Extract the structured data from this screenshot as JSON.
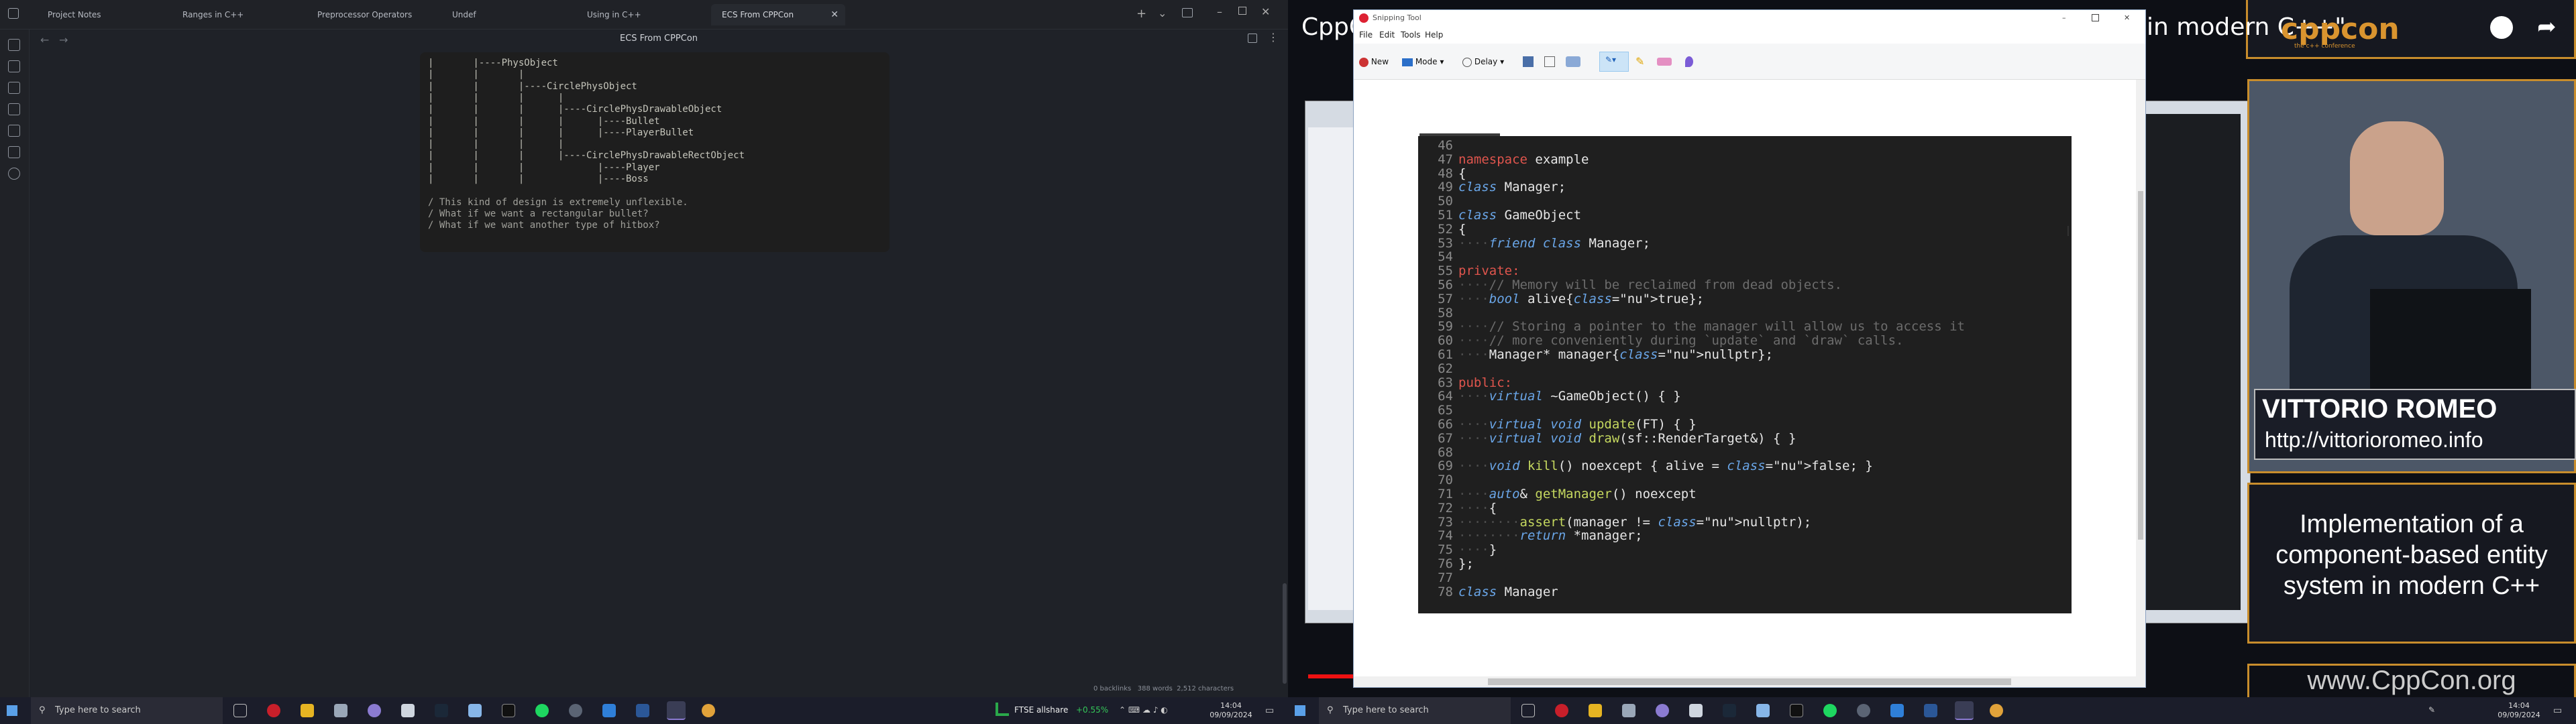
{
  "left_window": {
    "tabs": [
      {
        "label": "Project Notes"
      },
      {
        "label": "Ranges in C++"
      },
      {
        "label": "Preprocessor Operators"
      },
      {
        "label": "Undef"
      },
      {
        "label": "Using in C++"
      },
      {
        "label": "ECS From CPPCon"
      }
    ],
    "note_title": "ECS From CPPCon",
    "note_lines": [
      "|       |----PhysObject",
      "|       |       |",
      "|       |       |----CirclePhysObject",
      "|       |       |      |",
      "|       |       |      |----CirclePhysDrawableObject",
      "|       |       |      |      |----Bullet",
      "|       |       |      |      |----PlayerBullet",
      "|       |       |      |",
      "|       |       |      |----CirclePhysDrawableRectObject",
      "|       |       |             |----Player",
      "|       |       |             |----Boss",
      "",
      "/ This kind of design is extremely unflexible.",
      "/ What if we want a rectangular bullet?",
      "/ What if we want another type of hitbox?"
    ],
    "status": {
      "backlinks": "0 backlinks",
      "words": "388 words",
      "characters": "2,512 characters"
    }
  },
  "video": {
    "title_partial": "CppC",
    "title_right": "in modern C++\"",
    "logo": "cppcon",
    "logo_sub": "the c++ conference",
    "speaker_name": "VITTORIO ROMEO",
    "speaker_url": "http://vittorioromeo.info",
    "talk_title": "Implementation of a component-based entity system in modern C++",
    "site": "www.CppCon.org"
  },
  "snipping_tool": {
    "title": "Snipping Tool",
    "menu": [
      "File",
      "Edit",
      "Tools",
      "Help"
    ],
    "toolbar": {
      "new": "New",
      "mode": "Mode",
      "delay": "Delay"
    },
    "accent": "#cce4f7"
  },
  "code_lines": [
    {
      "n": "46",
      "t": ""
    },
    {
      "n": "47",
      "t": "namespace example"
    },
    {
      "n": "48",
      "t": "{"
    },
    {
      "n": "49",
      "t": "class Manager;"
    },
    {
      "n": "50",
      "t": ""
    },
    {
      "n": "51",
      "t": "class GameObject"
    },
    {
      "n": "52",
      "t": "{"
    },
    {
      "n": "53",
      "t": "    friend class Manager;"
    },
    {
      "n": "54",
      "t": ""
    },
    {
      "n": "55",
      "t": "private:"
    },
    {
      "n": "56",
      "t": "    // Memory will be reclaimed from dead objects."
    },
    {
      "n": "57",
      "t": "    bool alive{true};"
    },
    {
      "n": "58",
      "t": ""
    },
    {
      "n": "59",
      "t": "    // Storing a pointer to the manager will allow us to access it"
    },
    {
      "n": "60",
      "t": "    // more conveniently during `update` and `draw` calls."
    },
    {
      "n": "61",
      "t": "    Manager* manager{nullptr};"
    },
    {
      "n": "62",
      "t": ""
    },
    {
      "n": "63",
      "t": "public:"
    },
    {
      "n": "64",
      "t": "    virtual ~GameObject() { }"
    },
    {
      "n": "65",
      "t": ""
    },
    {
      "n": "66",
      "t": "    virtual void update(FT) { }"
    },
    {
      "n": "67",
      "t": "    virtual void draw(sf::RenderTarget&) { }"
    },
    {
      "n": "68",
      "t": ""
    },
    {
      "n": "69",
      "t": "    void kill() noexcept { alive = false; }"
    },
    {
      "n": "70",
      "t": ""
    },
    {
      "n": "71",
      "t": "    auto& getManager() noexcept"
    },
    {
      "n": "72",
      "t": "    {"
    },
    {
      "n": "73",
      "t": "        assert(manager != nullptr);"
    },
    {
      "n": "74",
      "t": "        return *manager;"
    },
    {
      "n": "75",
      "t": "    }"
    },
    {
      "n": "76",
      "t": "};"
    },
    {
      "n": "77",
      "t": ""
    },
    {
      "n": "78",
      "t": "class Manager"
    }
  ],
  "taskbar_left": {
    "search": "Type here to search",
    "stock": "FTSE allshare",
    "stock_change": "+0.55%",
    "time": "14:04",
    "date": "09/09/2024"
  },
  "taskbar_right": {
    "search": "Type here to search",
    "time": "14:04",
    "date": "09/09/2024"
  }
}
